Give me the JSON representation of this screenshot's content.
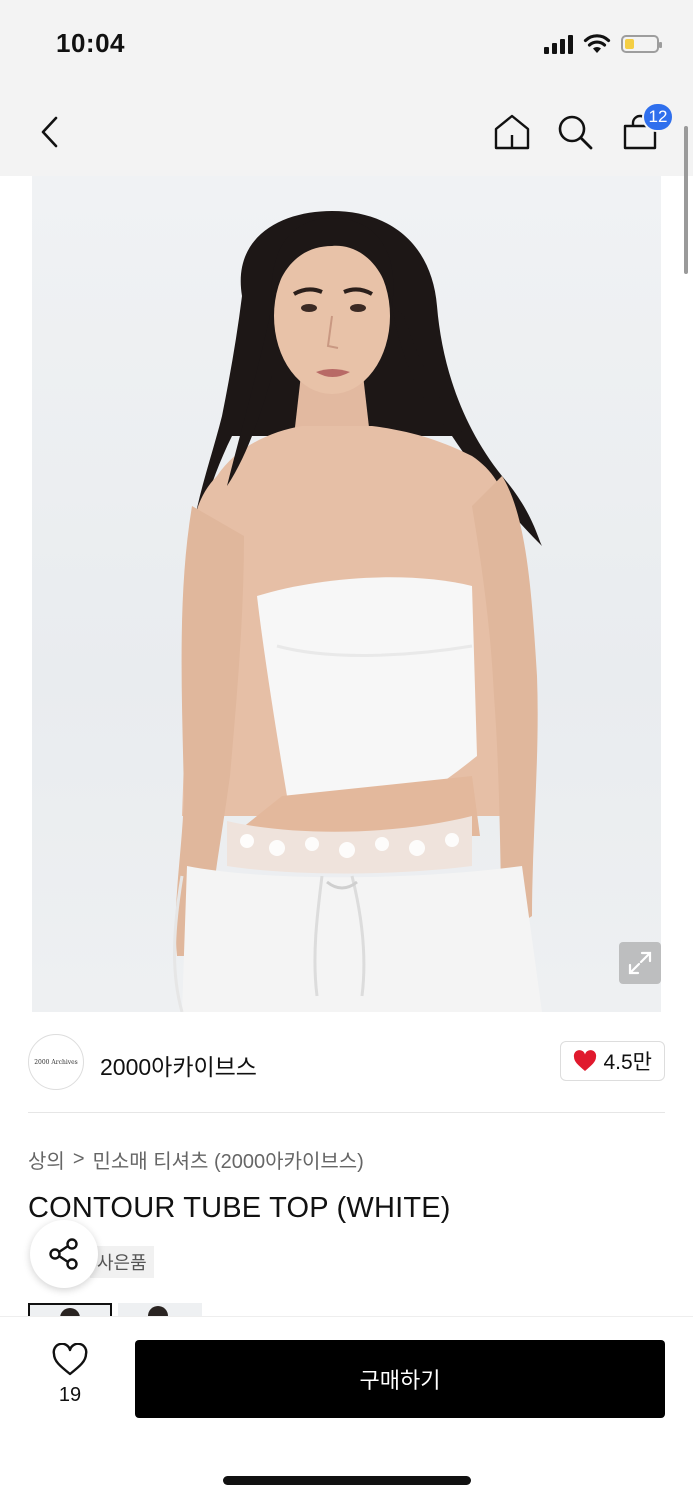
{
  "status_bar": {
    "time": "10:04",
    "icons": [
      "signal-icon",
      "wifi-icon",
      "battery-icon"
    ],
    "battery_level": 0.3
  },
  "nav": {
    "icons": [
      "back-icon",
      "home-icon",
      "search-icon",
      "cart-icon"
    ],
    "cart_count": "12"
  },
  "product": {
    "image_description_icon": "expand-icon",
    "brand": {
      "logo_text": "2000 Archives",
      "name": "2000아카이브스",
      "likes": "4.5만"
    },
    "breadcrumb": {
      "category": "상의",
      "separator": ">",
      "subcategory": "민소매 티셔츠 (2000아카이브스)"
    },
    "title": "CONTOUR TUBE TOP (WHITE)",
    "gift_tag": "사은품"
  },
  "bottom_bar": {
    "wish_count": "19",
    "buy_label": "구매하기"
  },
  "colors": {
    "accent_badge": "#2f6fed",
    "heart": "#e0192d",
    "buy_button": "#000000"
  }
}
